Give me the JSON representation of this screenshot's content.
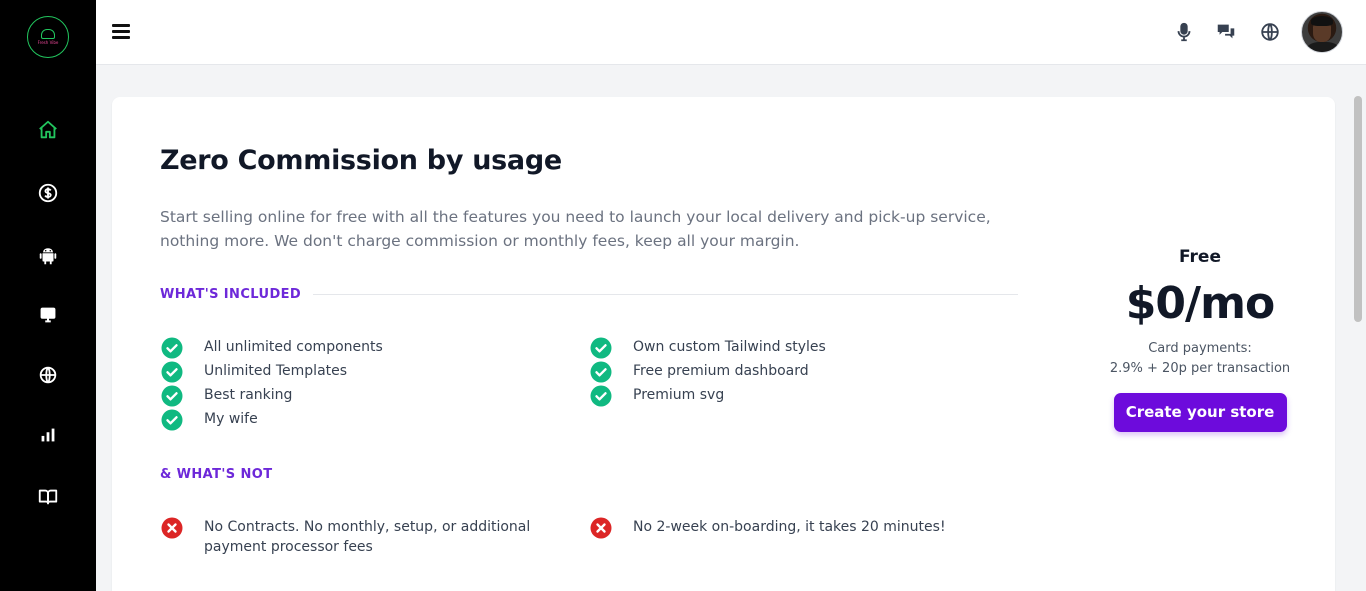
{
  "logo": {
    "brand_text": "Fresh Vibe",
    "accent_color": "#22c55e"
  },
  "sidebar": {
    "items": [
      {
        "icon": "home-icon",
        "active": true
      },
      {
        "icon": "dollar-icon",
        "active": false
      },
      {
        "icon": "android-icon",
        "active": false
      },
      {
        "icon": "desktop-icon",
        "active": false
      },
      {
        "icon": "globe-icon",
        "active": false
      },
      {
        "icon": "bar-chart-icon",
        "active": false
      },
      {
        "icon": "book-icon",
        "active": false
      }
    ]
  },
  "topbar": {
    "icons": [
      "microphone-icon",
      "chat-icon",
      "globe-icon"
    ],
    "avatar": "user-avatar"
  },
  "pricing": {
    "title": "Zero Commission by usage",
    "description": "Start selling online for free with all the features you need to launch your local delivery and pick-up service, nothing more. We don't charge commission or monthly fees, keep all your margin.",
    "included_heading": "WHAT'S INCLUDED",
    "included": [
      "All unlimited components",
      "Unlimited Templates",
      "Best ranking",
      "My wife",
      "Own custom Tailwind styles",
      "Free premium dashboard",
      "Premium svg"
    ],
    "excluded_heading": "& WHAT'S NOT",
    "excluded": [
      "No Contracts. No monthly, setup, or additional payment processor fees",
      "No 2-week on-boarding, it takes 20 minutes!"
    ],
    "plan_name": "Free",
    "price": "$0/mo",
    "card_payments_label": "Card payments:",
    "card_payments_rate": "2.9% + 20p per transaction",
    "cta_label": "Create your store",
    "colors": {
      "accent": "#6d28d9",
      "cta": "#6d0bdc",
      "check": "#10b981",
      "cross": "#dc2626"
    }
  }
}
